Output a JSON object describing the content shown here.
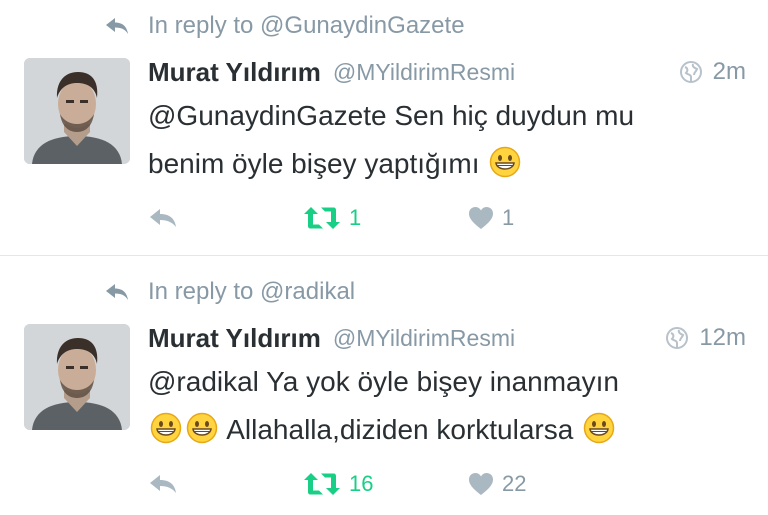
{
  "tweets": [
    {
      "in_reply_to": "In reply to @GunaydinGazete",
      "author_name": "Murat Yıldırım",
      "author_handle": "@MYildirimResmi",
      "time": "2m",
      "text_lines": [
        "@GunaydinGazete Sen hiç duydun mu",
        "benim öyle bişey yaptığımı"
      ],
      "retweets": "1",
      "likes": "1"
    },
    {
      "in_reply_to": "In reply to @radikal",
      "author_name": "Murat Yıldırım",
      "author_handle": "@MYildirimResmi",
      "time": "12m",
      "text_lines": [
        "@radikal Ya yok öyle bişey inanmayın",
        "Allahalla,diziden korktularsa"
      ],
      "retweets": "16",
      "likes": "22"
    }
  ],
  "colors": {
    "muted": "#8899a6",
    "retweet_active": "#19cf86",
    "text": "#292f33",
    "divider": "#e1e8ed"
  },
  "icons": {
    "reply": "reply-arrow-icon",
    "retweet": "retweet-icon",
    "like": "heart-icon",
    "globe": "globe-icon",
    "emoji": "grinning-face-emoji"
  }
}
